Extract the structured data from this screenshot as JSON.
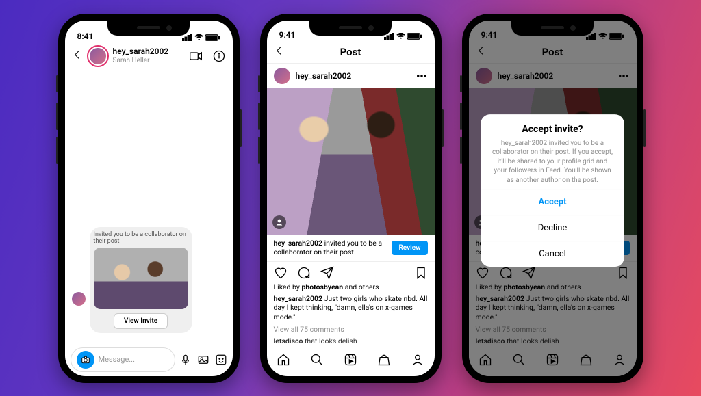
{
  "status": {
    "time_dm": "8:41",
    "time_post": "9:41",
    "time_modal": "9:41"
  },
  "user": {
    "handle": "hey_sarah2002",
    "display_name": "Sarah Heller"
  },
  "dm": {
    "invite_text": "Invited you to be a collaborator on their post.",
    "view_invite": "View Invite",
    "composer_placeholder": "Message..."
  },
  "post": {
    "screen_title": "Post",
    "collab_text_prefix": "hey_sarah2002",
    "collab_text_rest": " invited you to be a collaborator on their post.",
    "review": "Review",
    "likes_prefix": "Liked by ",
    "likes_user": "photosbyean",
    "likes_suffix": " and others",
    "caption_user": "hey_sarah2002",
    "caption_text": " Just two girls who skate nbd. All day I kept thinking, \"damn, ella's on x-games mode.\"",
    "comments_text": "View all 75 comments",
    "extra_user": "letsdisco",
    "extra_text": " that looks delish"
  },
  "modal": {
    "title": "Accept invite?",
    "body": "hey_sarah2002 invited you to be a collaborator on their post. If you accept, it'll be shared to your profile grid and your followers in Feed. You'll be shown as another author on the post.",
    "accept": "Accept",
    "decline": "Decline",
    "cancel": "Cancel"
  }
}
